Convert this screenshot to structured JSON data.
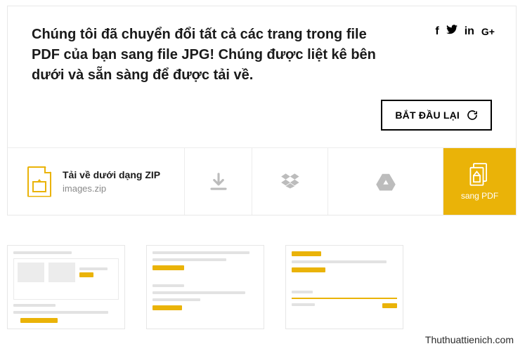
{
  "header": {
    "headline": "Chúng tôi đã chuyển đổi tất cả các trang trong file PDF của bạn sang file JPG! Chúng được liệt kê bên dưới và sẵn sàng để được tải về."
  },
  "restart": {
    "label": "BẮT ĐẦU LẠI"
  },
  "download": {
    "title": "Tải về dưới dạng ZIP",
    "filename": "images.zip"
  },
  "convert": {
    "label": "sang PDF"
  },
  "watermark": "Thuthuattienich.com"
}
